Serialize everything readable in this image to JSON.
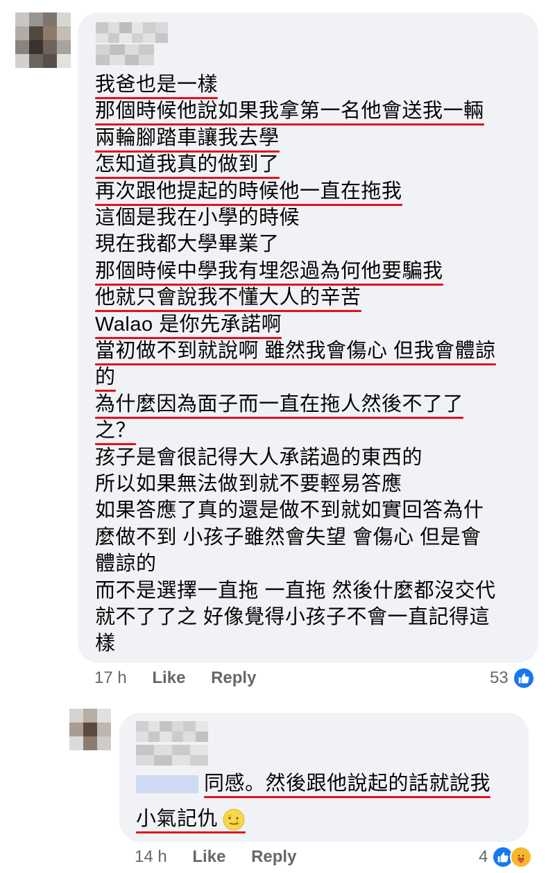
{
  "comment": {
    "lines": [
      {
        "segments": [
          {
            "t": "我爸也是一樣",
            "u": true
          }
        ]
      },
      {
        "segments": [
          {
            "t": "那個時候他說如果我拿第一名他會送我一輛",
            "u": true
          }
        ]
      },
      {
        "segments": [
          {
            "t": "兩輪腳踏車讓我去學",
            "u": true
          }
        ]
      },
      {
        "segments": [
          {
            "t": "怎知道我真的做到了",
            "u": true
          }
        ]
      },
      {
        "segments": [
          {
            "t": "再次跟他提起的時候他一直在拖我",
            "u": true
          }
        ]
      },
      {
        "segments": [
          {
            "t": "這個是我在小學的時候",
            "u": false
          }
        ]
      },
      {
        "segments": [
          {
            "t": "現在我都大學畢業了",
            "u": false
          }
        ]
      },
      {
        "segments": [
          {
            "t": "那個時候中學我有埋怨過為何他要騙我",
            "u": true
          }
        ]
      },
      {
        "segments": [
          {
            "t": "他就只會說我不懂大人的辛苦",
            "u": true
          }
        ]
      },
      {
        "segments": [
          {
            "t": "Walao 是你先承諾啊",
            "u": true
          }
        ]
      },
      {
        "segments": [
          {
            "t": "當初做不到就說啊 雖然我會傷心 但我會體諒",
            "u": true
          }
        ]
      },
      {
        "segments": [
          {
            "t": "的",
            "u": true
          }
        ]
      },
      {
        "segments": [
          {
            "t": "為什麼因為面子而一直在拖人然後不了了",
            "u": true
          }
        ]
      },
      {
        "segments": [
          {
            "t": "之？",
            "u": true
          }
        ]
      },
      {
        "segments": [
          {
            "t": "孩子是會很記得大人承諾過的東西的",
            "u": false
          }
        ]
      },
      {
        "segments": [
          {
            "t": "所以如果無法做到就不要輕易答應",
            "u": false
          }
        ]
      },
      {
        "segments": [
          {
            "t": "如果答應了真的還是做不到就如實回答為什",
            "u": false
          }
        ]
      },
      {
        "segments": [
          {
            "t": "麼做不到 小孩子雖然會失望 會傷心 但是會",
            "u": false
          }
        ]
      },
      {
        "segments": [
          {
            "t": "體諒的",
            "u": false
          }
        ]
      },
      {
        "segments": [
          {
            "t": "而不是選擇一直拖 一直拖 然後什麼都沒交代",
            "u": false
          }
        ]
      },
      {
        "segments": [
          {
            "t": "就不了了之 好像覺得小孩子不會一直記得這",
            "u": false
          }
        ]
      },
      {
        "segments": [
          {
            "t": "樣",
            "u": false
          }
        ]
      }
    ],
    "time": "17 h",
    "like_label": "Like",
    "reply_label": "Reply",
    "reaction_count": "53"
  },
  "reply": {
    "line1": "同感。然後跟他說起的話就說我",
    "line2": "小氣記仇",
    "time": "14 h",
    "like_label": "Like",
    "reply_label": "Reply",
    "reaction_count": "4"
  },
  "colors": {
    "bubble": "#f0f2f5",
    "underline": "#e1121c",
    "meta_text": "#65676b",
    "like_blue": "#1877f2",
    "care_yellow": "#f7b928"
  },
  "icons": {
    "like": "like-icon",
    "care": "care-icon",
    "emoji": "full-moon-face-emoji"
  }
}
